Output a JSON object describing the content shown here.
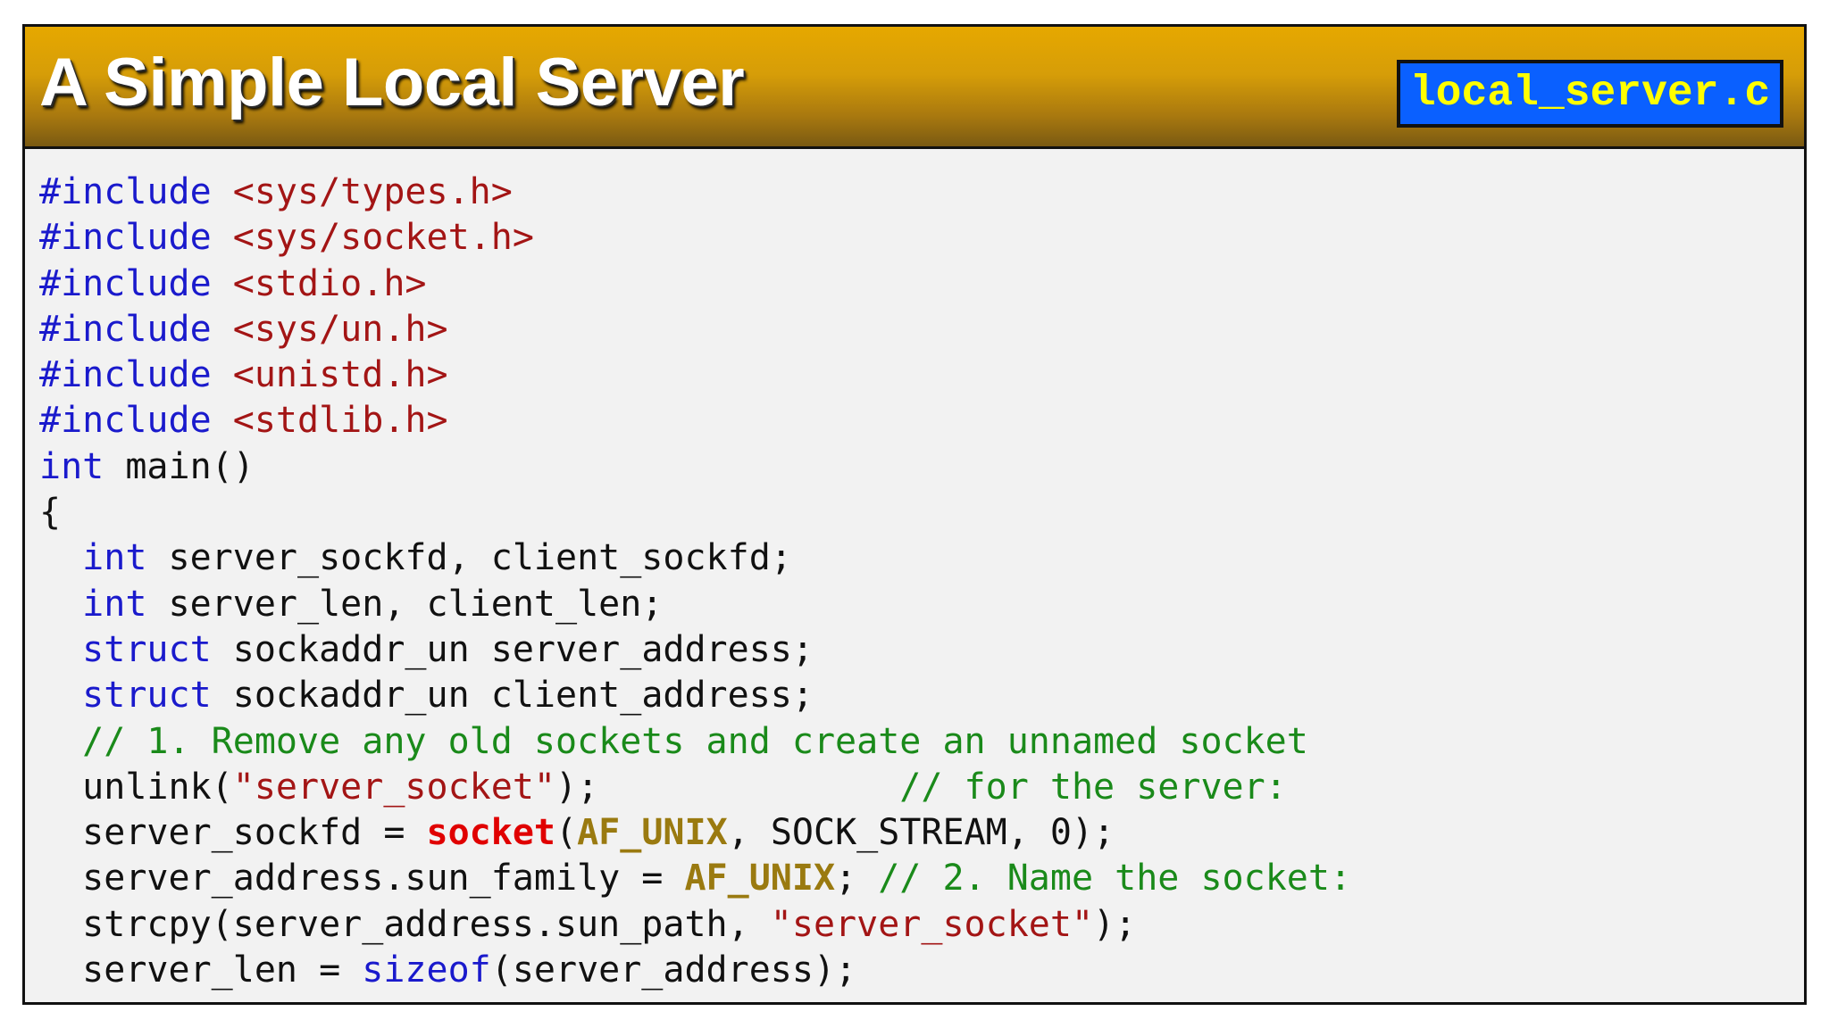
{
  "header": {
    "title": "A Simple Local Server",
    "filename": "local_server.c"
  },
  "colors": {
    "header_gold": "#e6a800",
    "badge_blue": "#0a60ff",
    "badge_text_yellow": "#ffff00",
    "keyword_blue": "#1a1acc",
    "string_red": "#a31515",
    "comment_green": "#1a8a1a",
    "function_red": "#e00000",
    "macro_gold": "#9a7a10",
    "background": "#f2f2f2"
  },
  "code_lines": [
    [
      {
        "t": "kw",
        "v": "#include "
      },
      {
        "t": "hdr",
        "v": "<sys/types.h>"
      }
    ],
    [
      {
        "t": "kw",
        "v": "#include "
      },
      {
        "t": "hdr",
        "v": "<sys/socket.h>"
      }
    ],
    [
      {
        "t": "kw",
        "v": "#include "
      },
      {
        "t": "hdr",
        "v": "<stdio.h>"
      }
    ],
    [
      {
        "t": "kw",
        "v": "#include "
      },
      {
        "t": "hdr",
        "v": "<sys/un.h>"
      }
    ],
    [
      {
        "t": "kw",
        "v": "#include "
      },
      {
        "t": "hdr",
        "v": "<unistd.h>"
      }
    ],
    [
      {
        "t": "kw",
        "v": "#include "
      },
      {
        "t": "hdr",
        "v": "<stdlib.h>"
      }
    ],
    [
      {
        "t": "kw",
        "v": "int"
      },
      {
        "t": "plain",
        "v": " main()"
      }
    ],
    [
      {
        "t": "plain",
        "v": "{"
      }
    ],
    [
      {
        "t": "plain",
        "v": "  "
      },
      {
        "t": "kw",
        "v": "int"
      },
      {
        "t": "plain",
        "v": " server_sockfd, client_sockfd;"
      }
    ],
    [
      {
        "t": "plain",
        "v": "  "
      },
      {
        "t": "kw",
        "v": "int"
      },
      {
        "t": "plain",
        "v": " server_len, client_len;"
      }
    ],
    [
      {
        "t": "plain",
        "v": "  "
      },
      {
        "t": "kw",
        "v": "struct"
      },
      {
        "t": "plain",
        "v": " sockaddr_un server_address;"
      }
    ],
    [
      {
        "t": "plain",
        "v": "  "
      },
      {
        "t": "kw",
        "v": "struct"
      },
      {
        "t": "plain",
        "v": " sockaddr_un client_address;"
      }
    ],
    [
      {
        "t": "plain",
        "v": "  "
      },
      {
        "t": "cm",
        "v": "// 1. Remove any old sockets and create an unnamed socket"
      }
    ],
    [
      {
        "t": "plain",
        "v": "  unlink("
      },
      {
        "t": "str",
        "v": "\"server_socket\""
      },
      {
        "t": "plain",
        "v": ");              "
      },
      {
        "t": "cm",
        "v": "// for the server:"
      }
    ],
    [
      {
        "t": "plain",
        "v": "  server_sockfd = "
      },
      {
        "t": "fn",
        "v": "socket"
      },
      {
        "t": "plain",
        "v": "("
      },
      {
        "t": "mac",
        "v": "AF_UNIX"
      },
      {
        "t": "plain",
        "v": ", SOCK_STREAM, 0);"
      }
    ],
    [
      {
        "t": "plain",
        "v": "  server_address.sun_family = "
      },
      {
        "t": "mac",
        "v": "AF_UNIX"
      },
      {
        "t": "plain",
        "v": "; "
      },
      {
        "t": "cm",
        "v": "// 2. Name the socket:"
      }
    ],
    [
      {
        "t": "plain",
        "v": "  strcpy(server_address.sun_path, "
      },
      {
        "t": "str",
        "v": "\"server_socket\""
      },
      {
        "t": "plain",
        "v": ");"
      }
    ],
    [
      {
        "t": "plain",
        "v": "  server_len = "
      },
      {
        "t": "kw",
        "v": "sizeof"
      },
      {
        "t": "plain",
        "v": "(server_address);"
      }
    ]
  ]
}
